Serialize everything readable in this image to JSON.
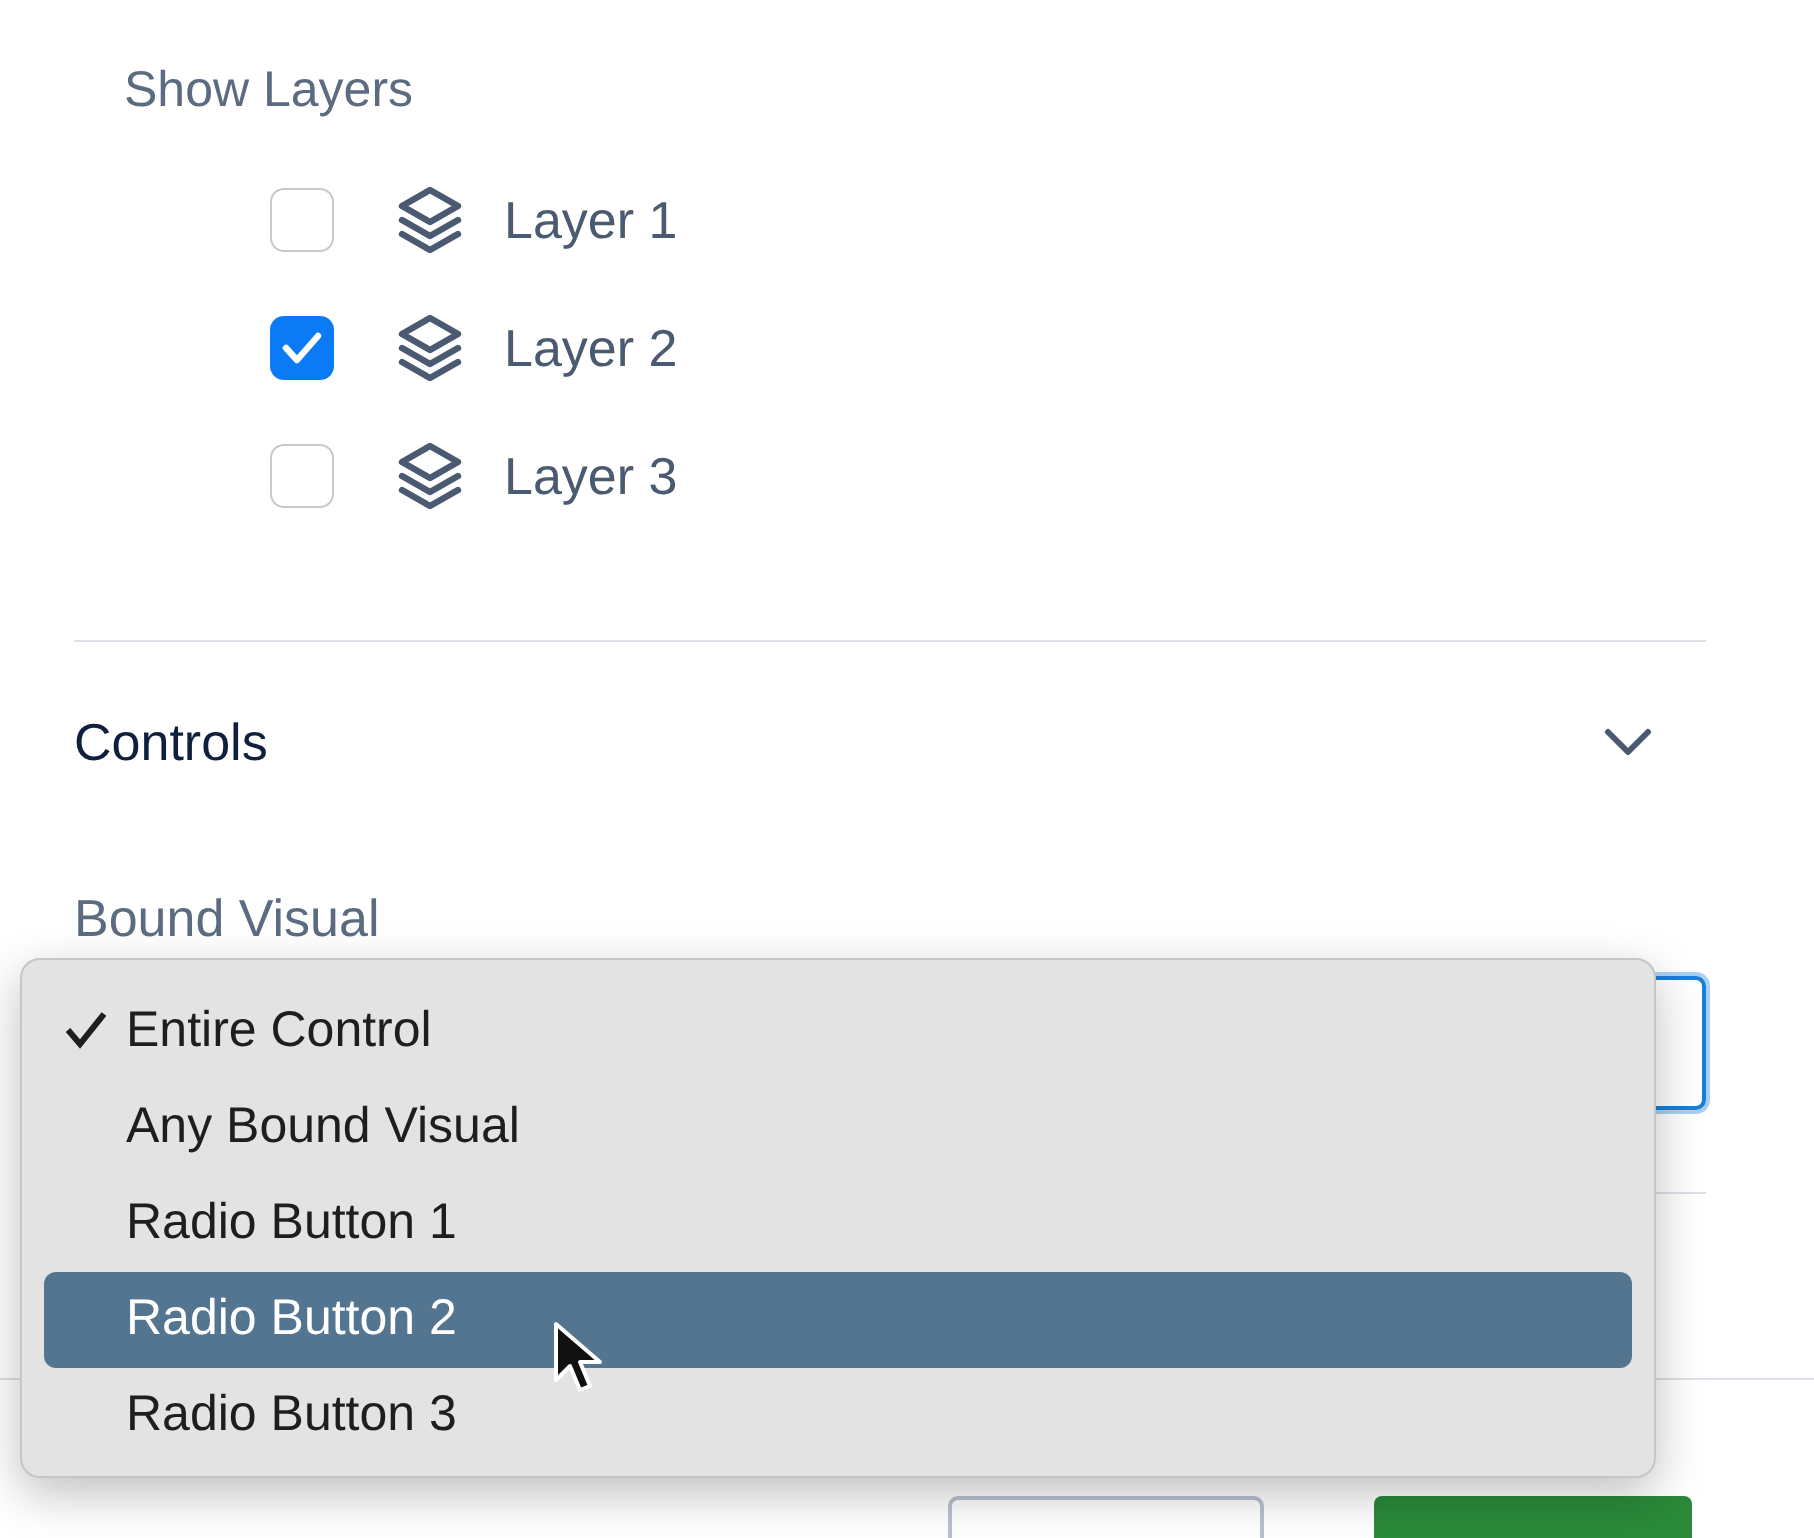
{
  "layers": {
    "title": "Show Layers",
    "items": [
      {
        "label": "Layer 1",
        "checked": false
      },
      {
        "label": "Layer 2",
        "checked": true
      },
      {
        "label": "Layer 3",
        "checked": false
      }
    ]
  },
  "controls": {
    "title": "Controls",
    "expanded": true,
    "bound_visual": {
      "label": "Bound Visual",
      "dropdown": {
        "open": true,
        "options": [
          {
            "label": "Entire Control",
            "checked": true,
            "highlighted": false
          },
          {
            "label": "Any Bound Visual",
            "checked": false,
            "highlighted": false
          },
          {
            "label": "Radio Button 1",
            "checked": false,
            "highlighted": false
          },
          {
            "label": "Radio Button 2",
            "checked": false,
            "highlighted": true
          },
          {
            "label": "Radio Button 3",
            "checked": false,
            "highlighted": false
          }
        ]
      }
    }
  }
}
